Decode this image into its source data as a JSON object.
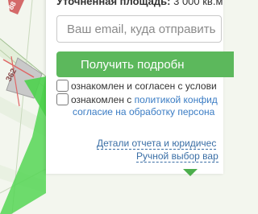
{
  "form": {
    "area_label": "Уточненная площадь:",
    "area_value": " 3 000 кв.м",
    "email_placeholder": "Ваш email, куда отправить",
    "submit_label": "Получить подробн",
    "consent_terms_text": "ознакомлен и согласен с услови",
    "consent_privacy_prefix": "ознакомлен с ",
    "consent_privacy_link": "политикой конфид",
    "consent_processing_link": "согласие на обработку персона",
    "details_link": "Детали отчета и юридичес",
    "manual_select_link": "Ручной выбор вар"
  },
  "map": {
    "plot_label_top": "88",
    "plot_label_left": "362"
  },
  "colors": {
    "accent_green": "#5cb85c",
    "link_blue": "#3a7cc4",
    "map_background": "#f3f6ee",
    "highlight_green": "#4cd24c"
  },
  "icons": {
    "pointer": "down-triangle-icon"
  }
}
